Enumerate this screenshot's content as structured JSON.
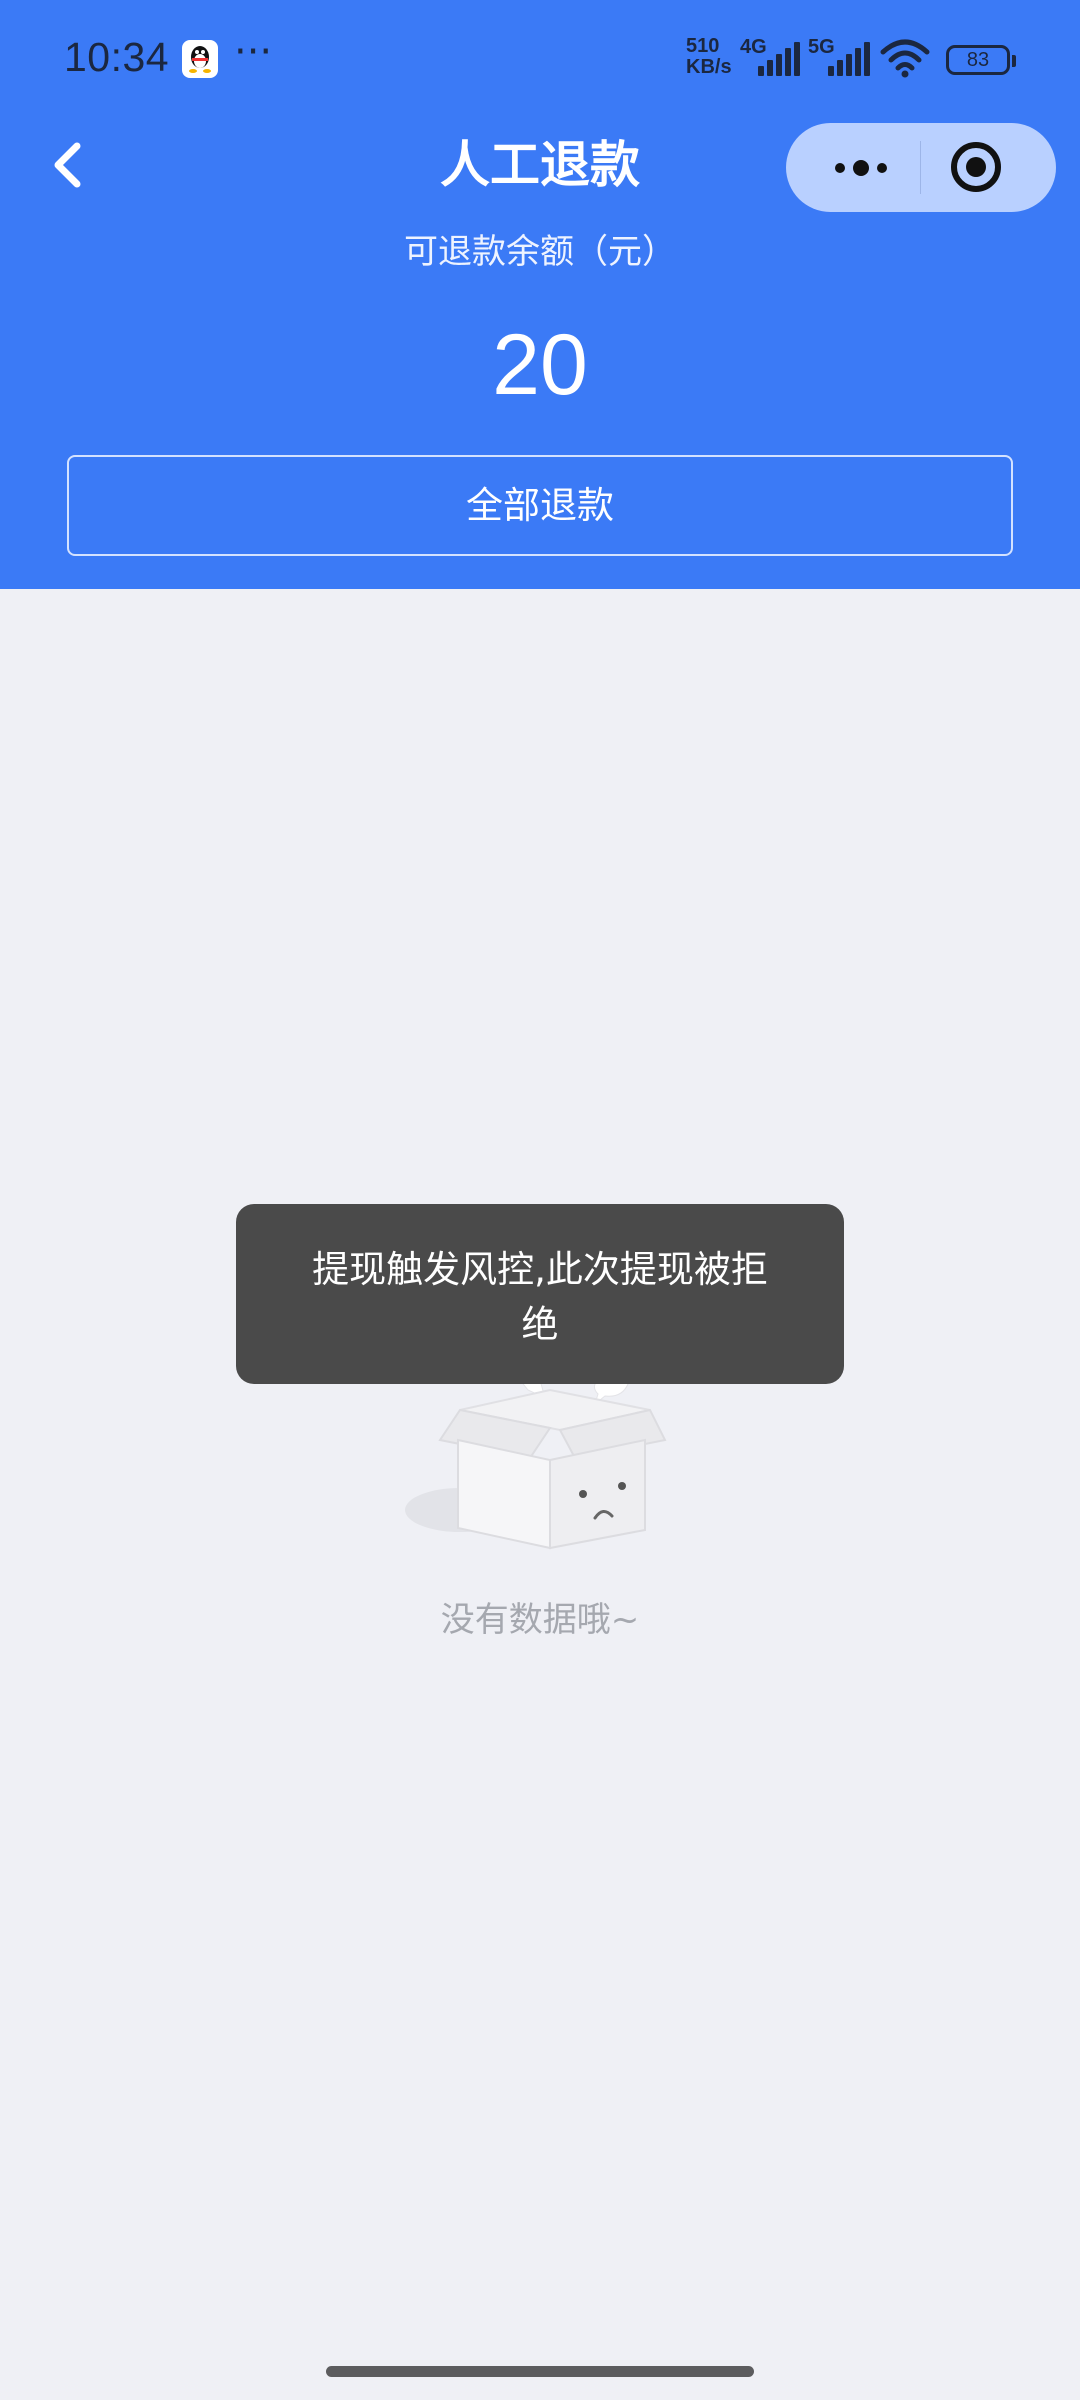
{
  "status_bar": {
    "time": "10:34",
    "dots": "···",
    "net_speed_value": "510",
    "net_speed_unit": "KB/s",
    "net_type_1": "4G",
    "net_type_2": "5G",
    "battery": "83"
  },
  "nav": {
    "title": "人工退款",
    "back_icon": "chevron-left-icon",
    "capsule_more_icon": "more-dots-icon",
    "capsule_close_icon": "target-close-icon"
  },
  "balance": {
    "label": "可退款余额（元）",
    "amount": "20"
  },
  "actions": {
    "refund_all_label": "全部退款"
  },
  "empty_state": {
    "icon": "empty-box-icon",
    "text": "没有数据哦~"
  },
  "toast": {
    "line1": "提现触发风控,此次提现被拒",
    "line2": "绝"
  },
  "colors": {
    "header_bg": "#3b7af6",
    "page_bg": "#eff0f5",
    "capsule_bg": "#b9d0ff",
    "toast_bg": "#4a4a4a"
  }
}
